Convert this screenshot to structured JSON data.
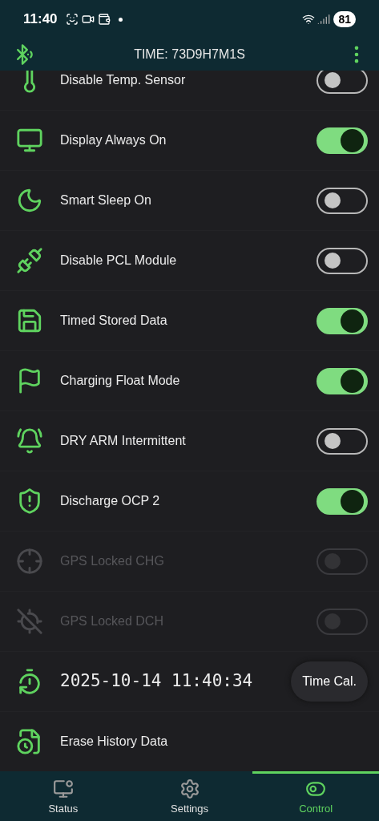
{
  "status_bar": {
    "time": "11:40",
    "battery": "81"
  },
  "app_bar": {
    "title": "TIME: 73D9H7M1S"
  },
  "rows": [
    {
      "kind": "toggle",
      "label": "Disable Temp. Sensor",
      "on": false,
      "disabled": false
    },
    {
      "kind": "toggle",
      "label": "Display Always On",
      "on": true,
      "disabled": false
    },
    {
      "kind": "toggle",
      "label": "Smart Sleep On",
      "on": false,
      "disabled": false
    },
    {
      "kind": "toggle",
      "label": "Disable PCL Module",
      "on": false,
      "disabled": false
    },
    {
      "kind": "toggle",
      "label": "Timed Stored Data",
      "on": true,
      "disabled": false
    },
    {
      "kind": "toggle",
      "label": "Charging Float Mode",
      "on": true,
      "disabled": false
    },
    {
      "kind": "toggle",
      "label": "DRY ARM Intermittent",
      "on": false,
      "disabled": false
    },
    {
      "kind": "toggle",
      "label": "Discharge OCP 2",
      "on": true,
      "disabled": false
    },
    {
      "kind": "toggle",
      "label": "GPS Locked CHG",
      "on": false,
      "disabled": true
    },
    {
      "kind": "toggle",
      "label": "GPS Locked DCH",
      "on": false,
      "disabled": true
    },
    {
      "kind": "clock",
      "value": "2025-10-14 11:40:34",
      "button": "Time Cal."
    },
    {
      "kind": "action",
      "label": "Erase History Data"
    }
  ],
  "tabs": [
    {
      "label": "Status",
      "selected": false
    },
    {
      "label": "Settings",
      "selected": false
    },
    {
      "label": "Control",
      "selected": true
    }
  ]
}
